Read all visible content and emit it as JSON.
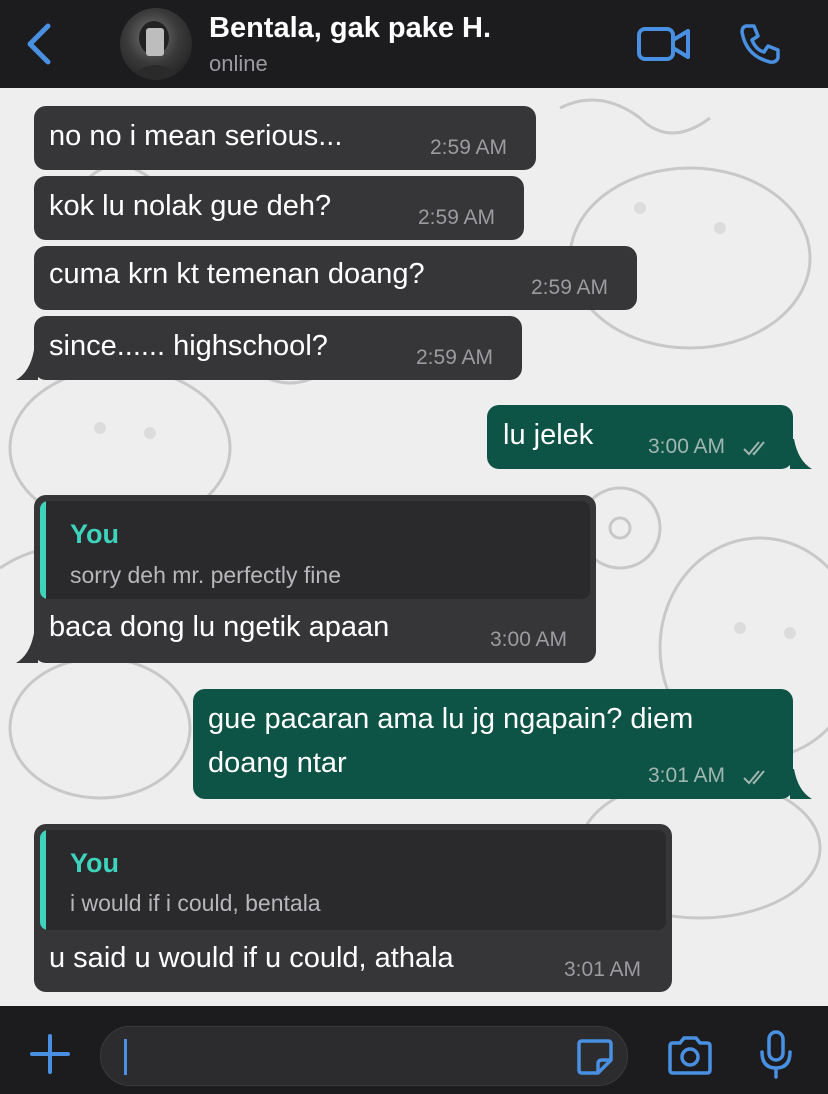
{
  "header": {
    "contact_name": "Bentala, gak pake H.",
    "status": "online"
  },
  "messages": [
    {
      "direction": "in",
      "text": "no no i mean serious...",
      "time": "2:59 AM"
    },
    {
      "direction": "in",
      "text": "kok lu nolak gue deh?",
      "time": "2:59 AM"
    },
    {
      "direction": "in",
      "text": "cuma krn kt temenan doang?",
      "time": "2:59 AM"
    },
    {
      "direction": "in",
      "text": "since...... highschool?",
      "time": "2:59 AM"
    },
    {
      "direction": "out",
      "text": "lu jelek",
      "time": "3:00 AM",
      "status": "read"
    },
    {
      "direction": "in",
      "reply_to": {
        "author": "You",
        "text": "sorry deh mr. perfectly fine"
      },
      "text": "baca dong lu ngetik apaan",
      "time": "3:00 AM"
    },
    {
      "direction": "out",
      "text_line1": "gue pacaran ama lu jg ngapain? diem",
      "text_line2": "doang ntar",
      "time": "3:01 AM",
      "status": "read"
    },
    {
      "direction": "in",
      "reply_to": {
        "author": "You",
        "text": "i would if i could, bentala"
      },
      "text": "u said u would if u could, athala",
      "time": "3:01 AM"
    }
  ],
  "composer": {
    "value": ""
  },
  "colors": {
    "accent": "#4a90e2",
    "incoming_bubble": "#363638",
    "outgoing_bubble": "#0e5446",
    "quote_accent": "#3ed3bd"
  },
  "icons": [
    "chevron-left-icon",
    "video-call-icon",
    "phone-icon",
    "plus-icon",
    "sticker-icon",
    "camera-icon",
    "microphone-icon",
    "double-check-icon"
  ]
}
